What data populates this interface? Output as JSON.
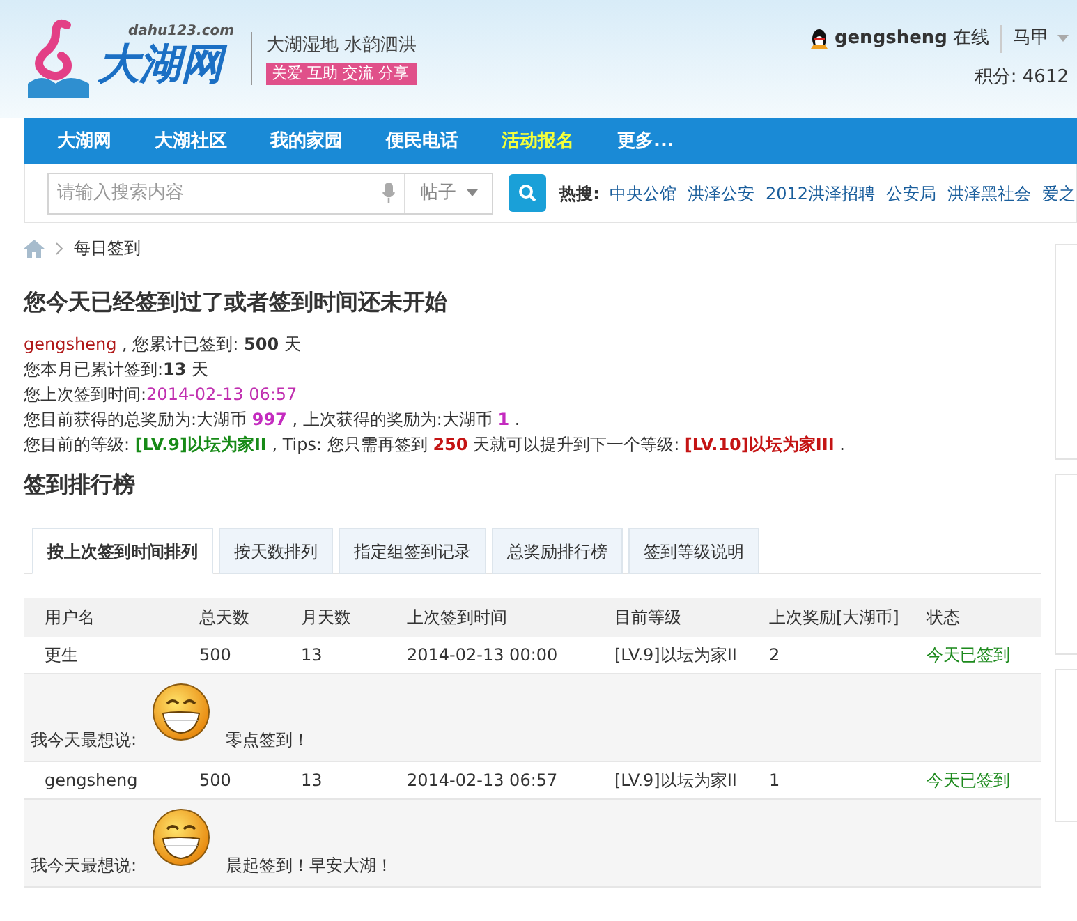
{
  "header": {
    "logo": {
      "domain": "dahu123.com",
      "name": "大湖网"
    },
    "slogan": "大湖湿地 水韵泗洪",
    "tagline": "关爱 互助 交流 分享",
    "user": {
      "name": "gengsheng",
      "status": "在线",
      "menu": "马甲",
      "points": "积分: 4612"
    }
  },
  "nav": {
    "items": [
      {
        "label": "大湖网",
        "highlighted": false
      },
      {
        "label": "大湖社区",
        "highlighted": false
      },
      {
        "label": "我的家园",
        "highlighted": false
      },
      {
        "label": "便民电话",
        "highlighted": false
      },
      {
        "label": "活动报名",
        "highlighted": true
      },
      {
        "label": "更多...",
        "highlighted": false
      }
    ]
  },
  "search": {
    "placeholder": "请输入搜索内容",
    "type": "帖子",
    "hot_label": "热搜:",
    "hot_links": [
      "中央公馆",
      "洪泽公安",
      "2012洪泽招聘",
      "公安局",
      "洪泽黑社会",
      "爱之"
    ]
  },
  "breadcrumb": [
    "每日签到"
  ],
  "message": {
    "title": "您今天已经签到过了或者签到时间还未开始",
    "lines": [
      [
        {
          "kind": "name",
          "text": "gengsheng"
        },
        {
          "kind": "text",
          "text": " , 您累计已签到: "
        },
        {
          "kind": "bold",
          "text": "500"
        },
        {
          "kind": "text",
          "text": " 天"
        }
      ],
      [
        {
          "kind": "text",
          "text": "您本月已累计签到:"
        },
        {
          "kind": "bold",
          "text": "13"
        },
        {
          "kind": "text",
          "text": " 天"
        }
      ],
      [
        {
          "kind": "text",
          "text": "您上次签到时间:"
        },
        {
          "kind": "date",
          "text": "2014-02-13 06:57"
        }
      ],
      [
        {
          "kind": "text",
          "text": "您目前获得的总奖励为:大湖币 "
        },
        {
          "kind": "value",
          "text": "997"
        },
        {
          "kind": "text",
          "text": " , 上次获得的奖励为:大湖币 "
        },
        {
          "kind": "value",
          "text": "1"
        },
        {
          "kind": "text",
          "text": " ."
        }
      ],
      [
        {
          "kind": "text",
          "text": "您目前的等级: "
        },
        {
          "kind": "level",
          "text": "[LV.9]以坛为家II"
        },
        {
          "kind": "text",
          "text": " , Tips: 您只需再签到 "
        },
        {
          "kind": "alert",
          "text": "250"
        },
        {
          "kind": "text",
          "text": " 天就可以提升到下一个等级: "
        },
        {
          "kind": "alert",
          "text": "[LV.10]以坛为家III"
        },
        {
          "kind": "text",
          "text": " ."
        }
      ]
    ]
  },
  "ranking": {
    "title": "签到排行榜",
    "tabs": [
      {
        "label": "按上次签到时间排列",
        "selected": true
      },
      {
        "label": "按天数排列",
        "selected": false
      },
      {
        "label": "指定组签到记录",
        "selected": false
      },
      {
        "label": "总奖励排行榜",
        "selected": false
      },
      {
        "label": "签到等级说明",
        "selected": false
      }
    ],
    "table": {
      "columns": [
        "用户名",
        "总天数",
        "月天数",
        "上次签到时间",
        "目前等级",
        "上次奖励[大湖币]",
        "状态"
      ],
      "rows": [
        {
          "user": "更生",
          "total": "500",
          "month": "13",
          "time": "2014-02-13 00:00",
          "level": "[LV.9]以坛为家II",
          "reward": "2",
          "status": "今天已签到",
          "say_label": "我今天最想说:",
          "say": "零点签到！"
        },
        {
          "user": "gengsheng",
          "total": "500",
          "month": "13",
          "time": "2014-02-13 06:57",
          "level": "[LV.9]以坛为家II",
          "reward": "1",
          "status": "今天已签到",
          "say_label": "我今天最想说:",
          "say": "晨起签到！早安大湖！"
        }
      ]
    }
  }
}
